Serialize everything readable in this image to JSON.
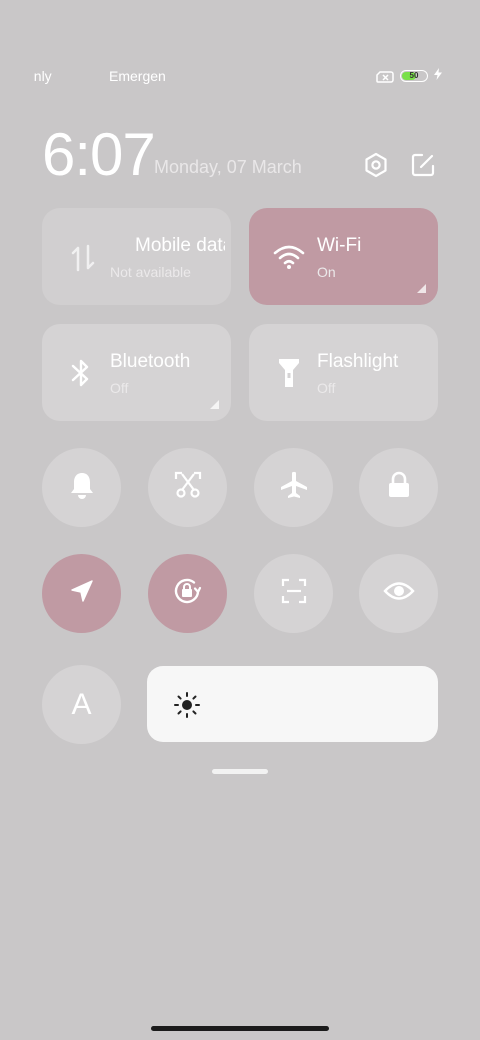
{
  "status_bar": {
    "left_text_1": "only",
    "left_text_2": "Emergency",
    "battery_level": "50",
    "colors": {
      "battery_fill": "#7ae04a"
    }
  },
  "header": {
    "time": "6:07",
    "date": "Monday, 07 March",
    "icons": [
      "settings-icon",
      "edit-icon"
    ]
  },
  "tiles": [
    {
      "name": "mobile-data",
      "title": "Mobile data",
      "subtitle": "Not available",
      "icon": "mobile-data-icon",
      "active": false
    },
    {
      "name": "wifi",
      "title": "Wi-Fi",
      "subtitle": "On",
      "icon": "wifi-icon",
      "active": true
    },
    {
      "name": "bluetooth",
      "title": "Bluetooth",
      "subtitle": "Off",
      "icon": "bluetooth-icon",
      "active": false
    },
    {
      "name": "flashlight",
      "title": "Flashlight",
      "subtitle": "Off",
      "icon": "flashlight-icon",
      "active": false
    }
  ],
  "toggles_row1": [
    {
      "name": "sound",
      "icon": "bell-icon",
      "active": false
    },
    {
      "name": "screenshot",
      "icon": "scissors-icon",
      "active": false
    },
    {
      "name": "airplane-mode",
      "icon": "airplane-icon",
      "active": false
    },
    {
      "name": "lock-screen",
      "icon": "lock-icon",
      "active": false
    }
  ],
  "toggles_row2": [
    {
      "name": "location",
      "icon": "location-arrow-icon",
      "active": true
    },
    {
      "name": "rotation-lock",
      "icon": "rotation-lock-icon",
      "active": true
    },
    {
      "name": "scanner",
      "icon": "scan-icon",
      "active": false
    },
    {
      "name": "reading-mode",
      "icon": "eye-icon",
      "active": false
    }
  ],
  "toggles_row3": [
    {
      "name": "auto-brightness",
      "icon": "letter-a-icon",
      "label": "A",
      "active": false
    }
  ],
  "brightness": {
    "icon": "sun-icon"
  },
  "colors": {
    "background": "#c9c7c8",
    "tile": "#d5d3d4",
    "accent": "#c09aa3"
  }
}
